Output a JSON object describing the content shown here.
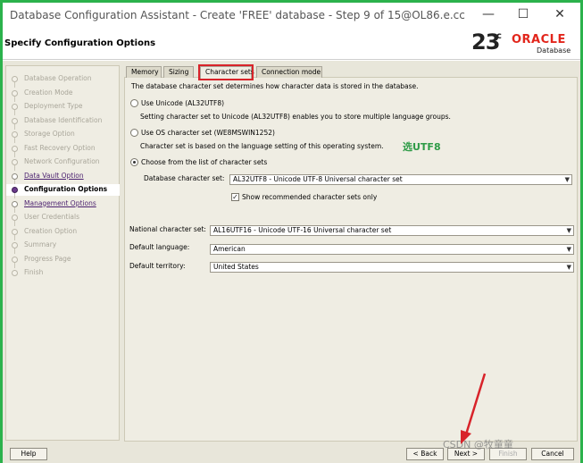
{
  "window": {
    "title": "Database Configuration Assistant - Create 'FREE' database - Step 9 of 15@OL86.e.cc",
    "minimize_icon": "minimize-icon",
    "maximize_icon": "maximize-icon",
    "close_icon": "close-icon"
  },
  "header": {
    "heading": "Specify Configuration Options",
    "logo_version": "23",
    "logo_sup": "c",
    "logo_brand": "ORACLE",
    "logo_sub": "Database"
  },
  "sidebar": {
    "items": [
      {
        "label": "Database Operation",
        "state": "disabled"
      },
      {
        "label": "Creation Mode",
        "state": "disabled"
      },
      {
        "label": "Deployment Type",
        "state": "disabled"
      },
      {
        "label": "Database Identification",
        "state": "disabled"
      },
      {
        "label": "Storage Option",
        "state": "disabled"
      },
      {
        "label": "Fast Recovery Option",
        "state": "disabled"
      },
      {
        "label": "Network Configuration",
        "state": "disabled"
      },
      {
        "label": "Data Vault Option",
        "state": "link"
      },
      {
        "label": "Configuration Options",
        "state": "active"
      },
      {
        "label": "Management Options",
        "state": "link"
      },
      {
        "label": "User Credentials",
        "state": "disabled"
      },
      {
        "label": "Creation Option",
        "state": "disabled"
      },
      {
        "label": "Summary",
        "state": "disabled"
      },
      {
        "label": "Progress Page",
        "state": "disabled"
      },
      {
        "label": "Finish",
        "state": "disabled"
      }
    ]
  },
  "tabs": [
    {
      "label": "Memory"
    },
    {
      "label": "Sizing"
    },
    {
      "label": "Character sets"
    },
    {
      "label": "Connection mode"
    }
  ],
  "charset": {
    "intro": "The database character set determines how character data is stored in the database.",
    "opt_unicode": "Use Unicode (AL32UTF8)",
    "opt_unicode_desc": "Setting character set to Unicode (AL32UTF8) enables you to store multiple language groups.",
    "opt_os": "Use OS character set (WE8MSWIN1252)",
    "opt_os_desc": "Character set is based on the language setting of this operating system.",
    "opt_list": "Choose from the list of character sets",
    "db_charset_label": "Database character set:",
    "db_charset_value": "AL32UTF8 - Unicode UTF-8 Universal character set",
    "show_recommended": "Show recommended character sets only",
    "annotation": "选UTF8"
  },
  "national": {
    "ncs_label": "National character set:",
    "ncs_value": "AL16UTF16 - Unicode UTF-16 Universal character set",
    "lang_label": "Default language:",
    "lang_value": "American",
    "terr_label": "Default territory:",
    "terr_value": "United States"
  },
  "footer": {
    "help": "Help",
    "back": "< Back",
    "next": "Next >",
    "finish": "Finish",
    "cancel": "Cancel"
  },
  "watermark": "CSDN @牧童童",
  "colors": {
    "frame": "#2bb24c",
    "highlight": "#d8232a",
    "annotation": "#2e9b47",
    "oracle_red": "#e2261c"
  }
}
